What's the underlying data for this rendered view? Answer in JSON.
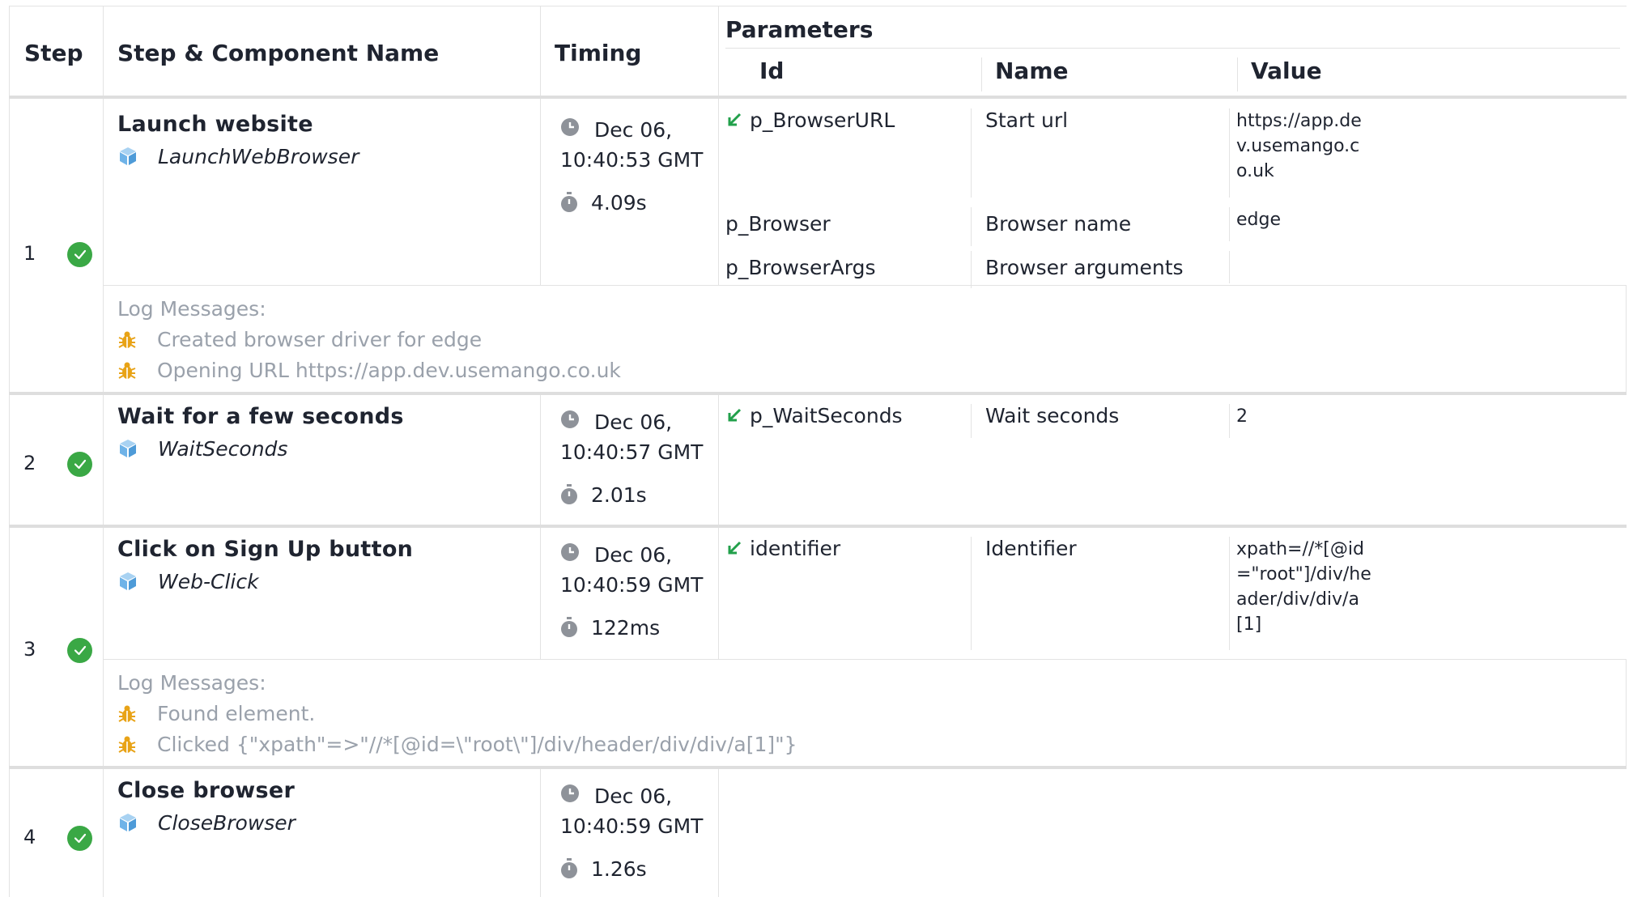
{
  "header": {
    "step": "Step",
    "name": "Step & Component Name",
    "timing": "Timing",
    "parameters": "Parameters",
    "param_id": "Id",
    "param_name": "Name",
    "param_value": "Value"
  },
  "colors": {
    "ok": "#3aa845",
    "cube": "#6fb3e8",
    "bug": "#e8a317",
    "arrow": "#22a04b",
    "icon_gray": "#8e9299"
  },
  "steps": [
    {
      "number": "1",
      "title": "Launch website",
      "component": "LaunchWebBrowser",
      "date": "Dec 06,",
      "time": "10:40:53 GMT",
      "duration": "4.09s",
      "params": [
        {
          "id": "p_BrowserURL",
          "name": "Start url",
          "value": "https://app.dev.usemango.co.uk",
          "arrow": true
        },
        {
          "id": "p_Browser",
          "name": "Browser name",
          "value": "edge",
          "arrow": false
        },
        {
          "id": "p_BrowserArgs",
          "name": "Browser arguments",
          "value": "",
          "arrow": false
        }
      ],
      "logs_label": "Log Messages:",
      "logs": [
        "Created browser driver for edge",
        "Opening URL https://app.dev.usemango.co.uk"
      ]
    },
    {
      "number": "2",
      "title": "Wait for a few seconds",
      "component": "WaitSeconds",
      "date": "Dec 06,",
      "time": "10:40:57 GMT",
      "duration": "2.01s",
      "params": [
        {
          "id": "p_WaitSeconds",
          "name": "Wait seconds",
          "value": "2",
          "arrow": true
        }
      ]
    },
    {
      "number": "3",
      "title": "Click on Sign Up button",
      "component": "Web-Click",
      "date": "Dec 06,",
      "time": "10:40:59 GMT",
      "duration": "122ms",
      "params": [
        {
          "id": "identifier",
          "name": "Identifier",
          "value": "xpath=//*[@id=\"root\"]/div/header/div/div/a[1]",
          "arrow": true
        }
      ],
      "logs_label": "Log Messages:",
      "logs": [
        "Found element.",
        "Clicked {\"xpath\"=>\"//*[@id=\\\"root\\\"]/div/header/div/div/a[1]\"}"
      ]
    },
    {
      "number": "4",
      "title": "Close browser",
      "component": "CloseBrowser",
      "date": "Dec 06,",
      "time": "10:40:59 GMT",
      "duration": "1.26s",
      "params": []
    }
  ]
}
